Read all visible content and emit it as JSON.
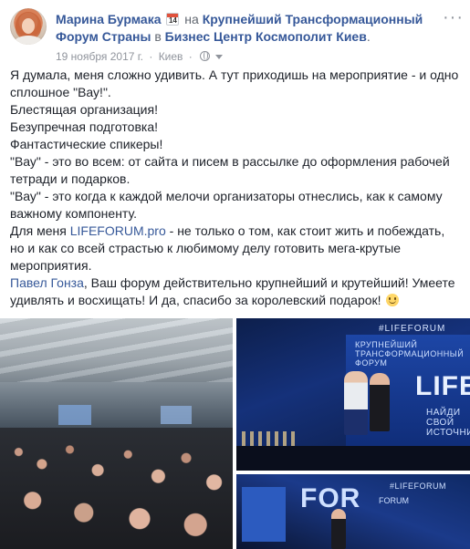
{
  "author": {
    "name": "Марина Бурмака",
    "calendar_day": "14",
    "preposition": "на",
    "event": "Крупнейший Трансформационный Форум Страны",
    "location_preposition": "в",
    "venue": "Бизнес Центр Космополит Киев",
    "period": "."
  },
  "meta": {
    "date": "19 ноября 2017 г.",
    "separator": "·",
    "place": "Киев",
    "separator2": "·"
  },
  "post": {
    "line1": "Я думала, меня сложно удивить. А тут приходишь на мероприятие - и одно сплошное \"Вау!\".",
    "line2": "Блестящая организация!",
    "line3": "Безупречная подготовка!",
    "line4": "Фантастические спикеры!",
    "line5": "\"Вау\" - это во всем: от сайта и писем в рассылке до оформления рабочей тетради и подарков.",
    "line6": "\"Вау\" - это когда к каждой мелочи организаторы отнеслись, как к самому важному компоненту.",
    "line7_prefix": "Для меня ",
    "line7_link": "LIFEFORUM.pro",
    "line7_suffix": " - не только о том, как стоит жить и побеждать, но и как со всей страстью к любимому делу готовить мега-крутые мероприятия.",
    "line8_link": "Павел Гонза",
    "line8_suffix": ", Ваш форум действительно крупнейший и крутейший! Умеете удивлять и восхищать! И да, спасибо за королевский подарок! "
  },
  "photos": {
    "top_right": {
      "banner_logo": "#LIFEFORUM",
      "banner_text": "КРУПНЕЙШИЙ ТРАНСФОРМАЦИОННЫЙ ФОРУМ",
      "brand": "LIFE",
      "tag": "НАЙДИ СВОЙ ИСТОЧНИК"
    },
    "bottom_right": {
      "brand": "FOR",
      "logo": "FORUM",
      "tag": "#LIFEFORUM"
    }
  },
  "icons": {
    "calendar": "calendar-icon",
    "globe": "globe-icon",
    "caret": "caret-down-icon",
    "options": "more-options-icon",
    "emoji": "smiley-icon"
  },
  "colors": {
    "link": "#365899",
    "meta": "#90949c",
    "text": "#1d2129"
  }
}
